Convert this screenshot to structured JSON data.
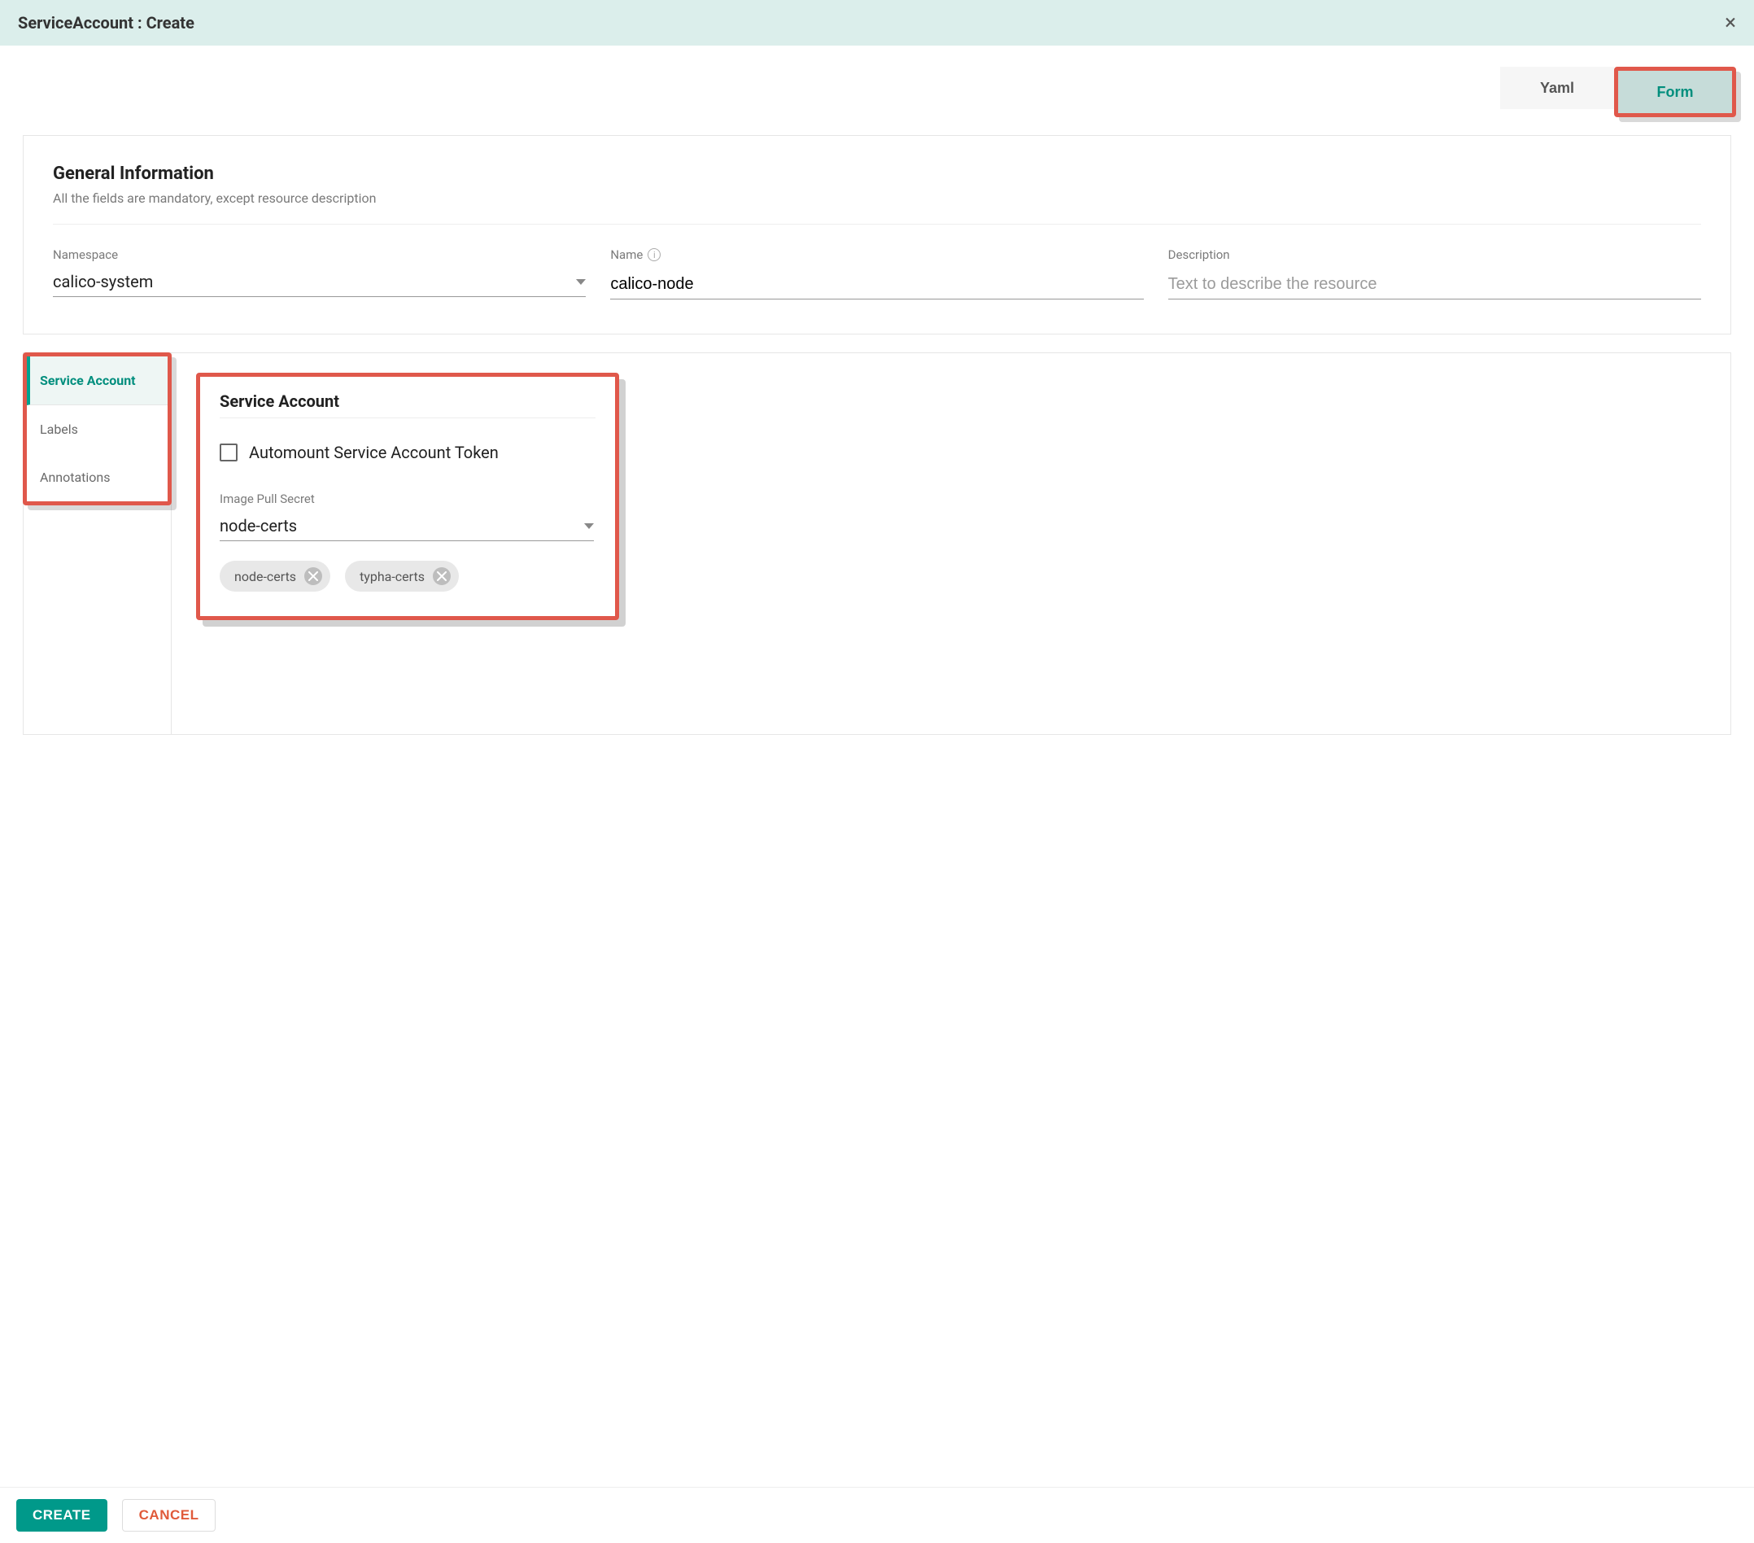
{
  "header": {
    "title": "ServiceAccount : Create"
  },
  "view_tabs": {
    "yaml": "Yaml",
    "form": "Form"
  },
  "general": {
    "section_title": "General Information",
    "section_sub": "All the fields are mandatory, except resource description",
    "namespace_label": "Namespace",
    "namespace_value": "calico-system",
    "name_label": "Name",
    "name_value": "calico-node",
    "description_label": "Description",
    "description_placeholder": "Text to describe the resource"
  },
  "side_tabs": {
    "service_account": "Service Account",
    "labels": "Labels",
    "annotations": "Annotations"
  },
  "service_account_panel": {
    "title": "Service Account",
    "automount_label": "Automount Service Account Token",
    "automount_checked": false,
    "ips_label": "Image Pull Secret",
    "ips_selected": "node-certs",
    "chips": [
      "node-certs",
      "typha-certs"
    ]
  },
  "footer": {
    "create": "CREATE",
    "cancel": "CANCEL"
  }
}
